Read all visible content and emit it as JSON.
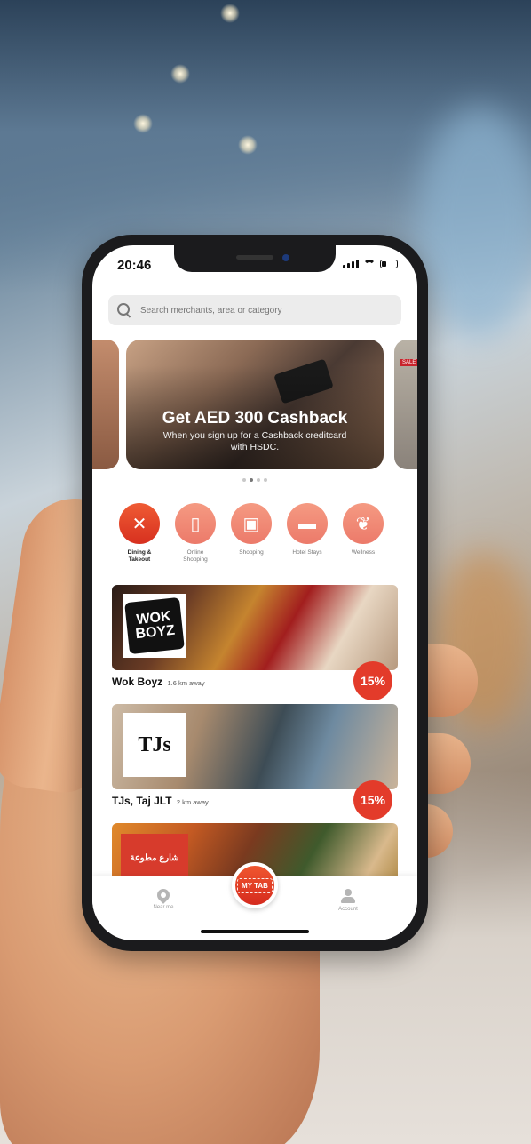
{
  "status": {
    "time": "20:46"
  },
  "search": {
    "placeholder": "Search merchants, area or category"
  },
  "banner": {
    "title": "Get AED 300 Cashback",
    "subtitle": "When you sign up for a Cashback creditcard with HSDC.",
    "side_tag": "SALE",
    "dots": 4,
    "active_dot": 1
  },
  "categories": [
    {
      "label": "Dining & Takeout",
      "icon": "fork-knife-icon",
      "active": true
    },
    {
      "label": "Online Shopping",
      "icon": "mobile-shop-icon",
      "active": false
    },
    {
      "label": "Shopping",
      "icon": "shopping-bag-icon",
      "active": false
    },
    {
      "label": "Hotel Stays",
      "icon": "bed-icon",
      "active": false
    },
    {
      "label": "Wellness",
      "icon": "lotus-icon",
      "active": false
    }
  ],
  "merchants": [
    {
      "name": "Wok Boyz",
      "distance": "1.6 km away",
      "discount": "15%",
      "logo_text": "WOK BOYZ"
    },
    {
      "name": "TJs, Taj JLT",
      "distance": "2 km away",
      "discount": "15%",
      "logo_text": "TJs"
    },
    {
      "name": "",
      "distance": "",
      "discount": "",
      "logo_text": "شارع مطوعة"
    }
  ],
  "nav": {
    "near_me": "Near me",
    "my_tab": "MY TAB",
    "account": "Account"
  },
  "colors": {
    "accent": "#e33b2a",
    "category": "#ec7a6a"
  }
}
